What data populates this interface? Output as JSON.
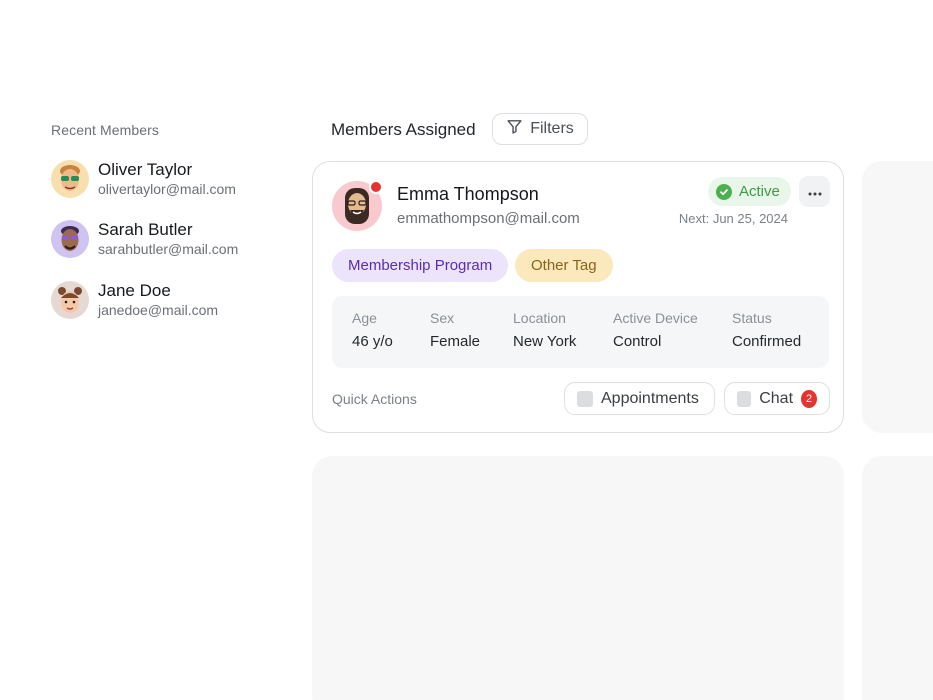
{
  "sidebar": {
    "title": "Recent Members",
    "members": [
      {
        "name": "Oliver Taylor",
        "email": "olivertaylor@mail.com",
        "avatar_bg": "#f8dfae"
      },
      {
        "name": "Sarah Butler",
        "email": "sarahbutler@mail.com",
        "avatar_bg": "#cfc3f0"
      },
      {
        "name": "Jane Doe",
        "email": "janedoe@mail.com",
        "avatar_bg": "#e6d9d3"
      }
    ]
  },
  "header": {
    "title": "Members Assigned",
    "filters_label": "Filters"
  },
  "card": {
    "name": "Emma Thompson",
    "email": "emmathompson@mail.com",
    "status": "Active",
    "next": "Next: Jun 25, 2024",
    "tags": [
      "Membership Program",
      "Other Tag"
    ],
    "info": [
      {
        "label": "Age",
        "value": "46 y/o"
      },
      {
        "label": "Sex",
        "value": "Female"
      },
      {
        "label": "Location",
        "value": "New York"
      },
      {
        "label": "Active Device",
        "value": "Control"
      },
      {
        "label": "Status",
        "value": "Confirmed"
      }
    ],
    "quick_actions_label": "Quick Actions",
    "actions": {
      "appointments_label": "Appointments",
      "chat_label": "Chat",
      "chat_count": "2"
    }
  },
  "colors": {
    "active_green": "#4caf50",
    "notification_red": "#e3342f",
    "tag_purple_bg": "#ece4fb",
    "tag_yellow_bg": "#fbe9bd"
  },
  "icons": {
    "filter": "filter-icon",
    "check": "check-circle-icon",
    "more": "more-horizontal-icon"
  }
}
